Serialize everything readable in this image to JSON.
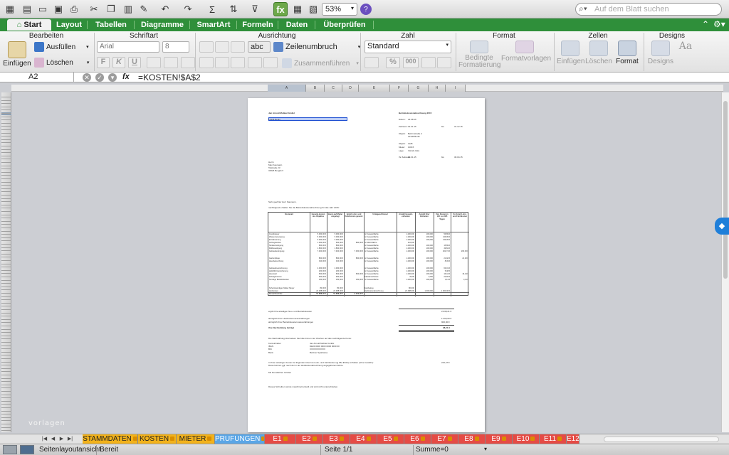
{
  "toolbar": {
    "zoom": "53%",
    "search_placeholder": "Auf dem Blatt suchen"
  },
  "ribbon_tabs": [
    "Start",
    "Layout",
    "Tabellen",
    "Diagramme",
    "SmartArt",
    "Formeln",
    "Daten",
    "Überprüfen"
  ],
  "ribbon": {
    "groups": {
      "bearbeiten": "Bearbeiten",
      "schriftart": "Schriftart",
      "ausrichtung": "Ausrichtung",
      "zahl": "Zahl",
      "format": "Format",
      "zellen": "Zellen",
      "designs": "Designs"
    },
    "einfuegen": "Einfügen",
    "ausfuellen": "Ausfüllen",
    "loeschen": "Löschen",
    "font_name": "Arial",
    "font_size": "8",
    "wrap": "Zeilenumbruch",
    "merge": "Zusammenführen",
    "wrap_icon": "abc",
    "number_format": "Standard",
    "bedingte": "Bedingte",
    "formatierung": "Formatierung",
    "formatvorlagen": "Formatvorlagen",
    "zellen_einfuegen": "Einfügen",
    "zellen_loeschen": "Löschen",
    "zellen_format": "Format",
    "designs_btn": "Designs",
    "bold": "F",
    "italic": "K",
    "underline": "U",
    "percent": "%",
    "thousand": "000"
  },
  "formula_bar": {
    "cell_ref": "A2",
    "formula": "=KOSTEN!$A$2",
    "fx": "fx"
  },
  "column_headers": [
    "A",
    "B",
    "C",
    "D",
    "E",
    "F",
    "G",
    "H",
    "I"
  ],
  "page": {
    "company": "Jan Arnold Mobbel GmbH",
    "company_city": "12345 Berlin",
    "title": "Betriebskostenabrechnung 2015",
    "datum_label": "Datum:",
    "datum": "24.08.16",
    "zeitraum_label": "Zeitraum:",
    "zeitraum_von": "01.01.15",
    "zeitraum_bis_label": "bis",
    "zeitraum_bis": "31.12.15",
    "objekt_label": "Objekt:",
    "objekt": "Behrmstraße 4",
    "objekt_city": "12345 Berlin",
    "objekt2_label": "Objekt:",
    "objekt2": "1128",
    "mieter_label": "Mieter:",
    "mieter": "10015",
    "lage_label": "Lage:",
    "lage": "VH EG links",
    "ihr_zeitraum_label": "Ihr Zeitraum:",
    "ihr_zeitraum_von": "01.01.15",
    "ihr_zeitraum_bis_label": "bis",
    "ihr_zeitraum_bis": "30.04.15",
    "recipient_salutation": "Herrn",
    "recipient_name": "Max Kaumann",
    "recipient_street": "Talstraße 23",
    "recipient_city": "34626 Bergdorf",
    "greeting": "Sehr geehrter Herr Kaumann,",
    "intro": "nachfolgend erhalten Sie die Betriebskostenabrechnung für das Jahr 2015:",
    "table_headers": [
      "Kostenart",
      "Gesamt-kosten des Objektes",
      "davon auf Mieter umgelegt",
      "Anteil Lohn- und Fahrtkosten gesamt",
      "Umlageschlüssel",
      "Anzahl Gesamt-einheiten",
      "Anzahl Ihrer Einheiten",
      "Ihre Kosten in 120 von 365 Tagen",
      "Ihr Anteil Lohn- und Fahrtkosten"
    ],
    "table_rows": [
      [
        "Grundsteuer",
        "5.000,00 €",
        "5.000,00 €",
        "",
        "m² Gesamtfläche",
        "1.200,000",
        "100,000",
        "56,89 €",
        ""
      ],
      [
        "Wasserversorgung",
        "5.000,00 €",
        "5.000,00 €",
        "",
        "m² Gesamtfläche",
        "1.200,000",
        "100,000",
        "136,99 €",
        ""
      ],
      [
        "Entwässerung",
        "5.000,00 €",
        "5.000,00 €",
        "",
        "m² Gesamtfläche",
        "1.200,000",
        "100,000",
        "136,99 €",
        ""
      ],
      [
        "Aufzugskosten",
        "1.000,00 €",
        "600,00 €",
        "860,00 €",
        "m² Wohnfläche",
        "110,000",
        "",
        "",
        ""
      ],
      [
        "Straßenreinigung",
        "800,00 €",
        "800,00 €",
        "",
        "m² Gesamtfläche",
        "1.200,000",
        "100,000",
        "15,89 €",
        ""
      ],
      [
        "Müllbeseitigung",
        "1.800,00 €",
        "1.800,00 €",
        "",
        "m² Gesamtfläche",
        "1.200,000",
        "100,000",
        "49,84 €",
        ""
      ],
      [
        "Gebäudereinigung",
        "7.400,00 €",
        "7.400,00 €",
        "7.300,00 €",
        "m² Gesamtfläche",
        "1.200,000",
        "100,000",
        "202,74 €",
        "200,00 €"
      ],
      [
        "Gartenpflege",
        "800,00 €",
        "800,00 €",
        "800,00 €",
        "m² Gesamtfläche",
        "1.200,000",
        "100,000",
        "21,92 €",
        "21,92 €"
      ],
      [
        "Hausbeleuchtung",
        "310,00 €",
        "310,00 €",
        "",
        "m² Gesamtfläche",
        "1.200,000",
        "100,000",
        "8,49 €",
        ""
      ],
      [
        "Gebäudeversicherung",
        "2.300,00 €",
        "2.300,00 €",
        "",
        "m² Gesamtfläche",
        "1.200,000",
        "100,000",
        "63,01 €",
        ""
      ],
      [
        "Haftpflichtversicherung",
        "200,00 €",
        "200,00 €",
        "",
        "m² Gesamtfläche",
        "1.200,000",
        "100,000",
        "5,48 €",
        ""
      ],
      [
        "Hauswart",
        "600,00 €",
        "600,00 €",
        "600,00 €",
        "m² Gesamtfläche",
        "1.200,000",
        "100,000",
        "16,44 €",
        "16,44 €"
      ],
      [
        "Kabelgebühren",
        "900,00 €",
        "900,00 €",
        "",
        "Kabelanschlüsse",
        "8,000",
        "1,000",
        "24,66 €",
        ""
      ],
      [
        "Sonstige Betriebskosten",
        "150,00 €",
        "150,00 €",
        "150,00 €",
        "m² Gesamtfläche",
        "1.200,000",
        "100,000",
        "4,11 €",
        "4,11 €"
      ],
      [
        "Schornsteinfeger Mieter Meyer",
        "80,00 €",
        "80,00 €",
        "",
        "Festbetrag",
        "80,000",
        "",
        "",
        ""
      ],
      [
        "Heizkosten",
        "22.488,00 €",
        "22.488,00 €",
        "",
        "Heizkostenabrechnung",
        "22.488,000",
        "1.000,000",
        "1.000,00 €",
        ""
      ],
      [
        "Gesamtsumme",
        "53.888,00 €",
        "53.888,00 €",
        "9.910,00 €",
        "",
        "",
        "",
        "",
        ""
      ]
    ],
    "sum_label": "ergibt Ihre anteiligen Neu- und Betriebskosten",
    "sum_value": "2.038,21 €",
    "prepay1_label": "abzüglich Ihrer Heizkostenvorauszahlungen",
    "prepay1_value": "1.200,00 €",
    "prepay2_label": "abzüglich Ihrer Betriebskostenvorauszahlungen",
    "prepay2_value": "900,00 €",
    "result_label": "Ihre Nachzahlung beträgt",
    "result_value": "38,21 €",
    "payment_note": "Die Nachzahlung überweisen Sie bitte binnen vier Wochen auf das nachfolgende Konto:",
    "bank": [
      [
        "Kontoinhaber",
        "Jan Arnold Mobbel GmbH"
      ],
      [
        "IBAN",
        "DE00 0000 0000 0000 0000 00"
      ],
      [
        "BIC",
        "XXXXXXXXXXX"
      ],
      [
        "Bank",
        "Berliner Sparkasse"
      ]
    ],
    "tax_note": "In Ihren anteiligen Kosten ist folgender Anteil an Lohn- und Fahrtkosten (§ 35a EStG) enthalten (ohne Gewähr):",
    "tax_value": "242,47 €",
    "tax_note2": "Diese können ggf. nach der in der Heizkostenabrechnung angegebenen Werte.",
    "closing": "Mit freundlichen Grüßen",
    "footer": "Dieses Schreiben wurde maschinell erstellt und wird nicht unterschrieben."
  },
  "sheet_tabs": [
    {
      "label": "STAMMDATEN",
      "color": "y"
    },
    {
      "label": "KOSTEN",
      "color": "y"
    },
    {
      "label": "MIETER",
      "color": "y"
    },
    {
      "label": "PRUFUNGEN",
      "color": "b"
    },
    {
      "label": "E1",
      "color": "r"
    },
    {
      "label": "E2",
      "color": "r"
    },
    {
      "label": "E3",
      "color": "r"
    },
    {
      "label": "E4",
      "color": "r"
    },
    {
      "label": "E5",
      "color": "r"
    },
    {
      "label": "E6",
      "color": "r"
    },
    {
      "label": "E7",
      "color": "r"
    },
    {
      "label": "E8",
      "color": "r"
    },
    {
      "label": "E9",
      "color": "r"
    },
    {
      "label": "E10",
      "color": "r"
    },
    {
      "label": "E11",
      "color": "r"
    },
    {
      "label": "E12",
      "color": "r"
    }
  ],
  "status_bar": {
    "view": "Seitenlayoutansicht",
    "state": "Bereit",
    "page": "Seite 1/1",
    "sum": "Summe=0"
  },
  "watermark": "vorlagen",
  "colors": {
    "ribbon_green": "#2f8f3a",
    "tab_yellow": "#f2b21b",
    "tab_blue": "#5aa6e6",
    "tab_red": "#e54b45"
  }
}
